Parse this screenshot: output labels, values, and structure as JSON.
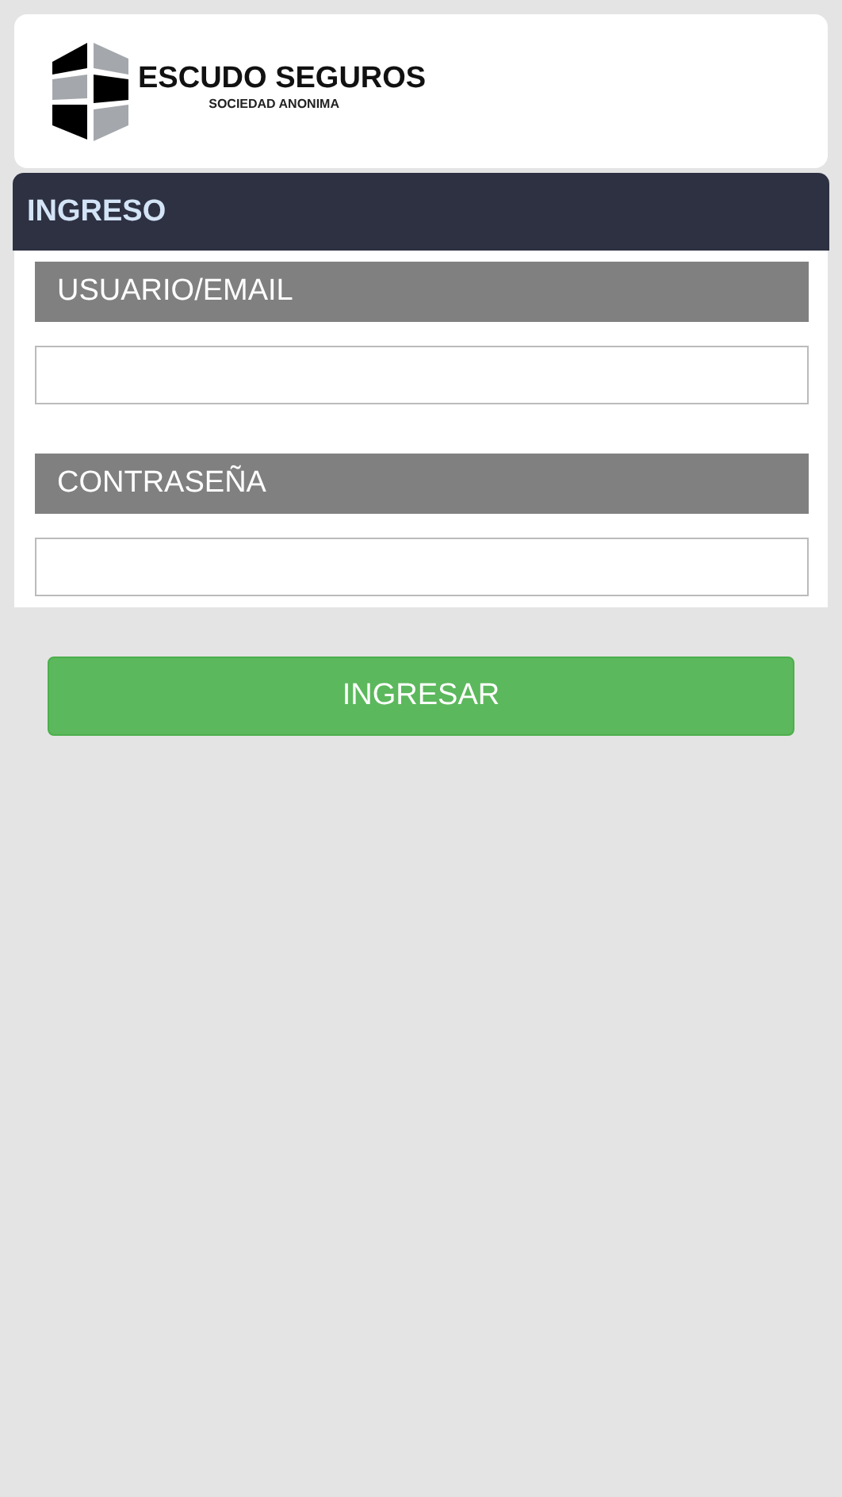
{
  "logo": {
    "name": "ESCUDO SEGUROS",
    "tagline": "SOCIEDAD ANONIMA"
  },
  "panel": {
    "title": "INGRESO"
  },
  "fields": [
    {
      "label": "USUARIO/EMAIL"
    },
    {
      "label": "CONTRASEÑA"
    }
  ],
  "submit": {
    "label": "INGRESAR"
  }
}
